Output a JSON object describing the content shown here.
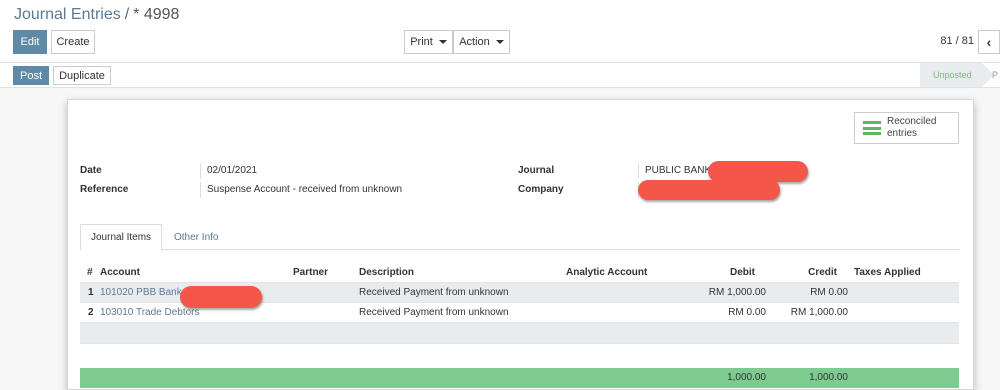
{
  "breadcrumb": {
    "parent": "Journal Entries",
    "separator": "/",
    "current": "* 4998"
  },
  "buttons": {
    "edit": "Edit",
    "create": "Create",
    "print": "Print",
    "action": "Action",
    "post": "Post",
    "duplicate": "Duplicate"
  },
  "pager": {
    "value": "81 / 81",
    "prev_icon": "‹"
  },
  "status": {
    "current": "Unposted",
    "next": "P"
  },
  "smart_button": {
    "label_line1": "Reconciled",
    "label_line2": "entries",
    "icon": "list-icon",
    "icon_color": "#5cb85c"
  },
  "fields": {
    "date_label": "Date",
    "date_value": "02/01/2021",
    "reference_label": "Reference",
    "reference_value": "Suspense Account - received from unknown",
    "journal_label": "Journal",
    "journal_value": "PUBLIC BANK",
    "company_label": "Company",
    "company_value": ""
  },
  "tabs": {
    "items": "Journal Items",
    "other": "Other Info"
  },
  "table": {
    "headers": {
      "num": "#",
      "account": "Account",
      "partner": "Partner",
      "description": "Description",
      "analytic": "Analytic Account",
      "debit": "Debit",
      "credit": "Credit",
      "taxes": "Taxes Applied"
    },
    "rows": [
      {
        "num": "1",
        "account": "101020 PBB Bank",
        "partner": "",
        "description": "Received Payment from unknown",
        "analytic": "",
        "debit": "RM 1,000.00",
        "credit": "RM 0.00",
        "taxes": ""
      },
      {
        "num": "2",
        "account": "103010 Trade Debtors",
        "partner": "",
        "description": "Received Payment from unknown",
        "analytic": "",
        "debit": "RM 0.00",
        "credit": "RM 1,000.00",
        "taxes": ""
      }
    ],
    "totals": {
      "debit": "1,000.00",
      "credit": "1,000.00"
    }
  },
  "colors": {
    "primary": "#5f8aa6",
    "link": "#5d7b94",
    "total_row": "#7ecb8f",
    "redaction": "#f4574a",
    "status_current": "#7cb87c"
  }
}
